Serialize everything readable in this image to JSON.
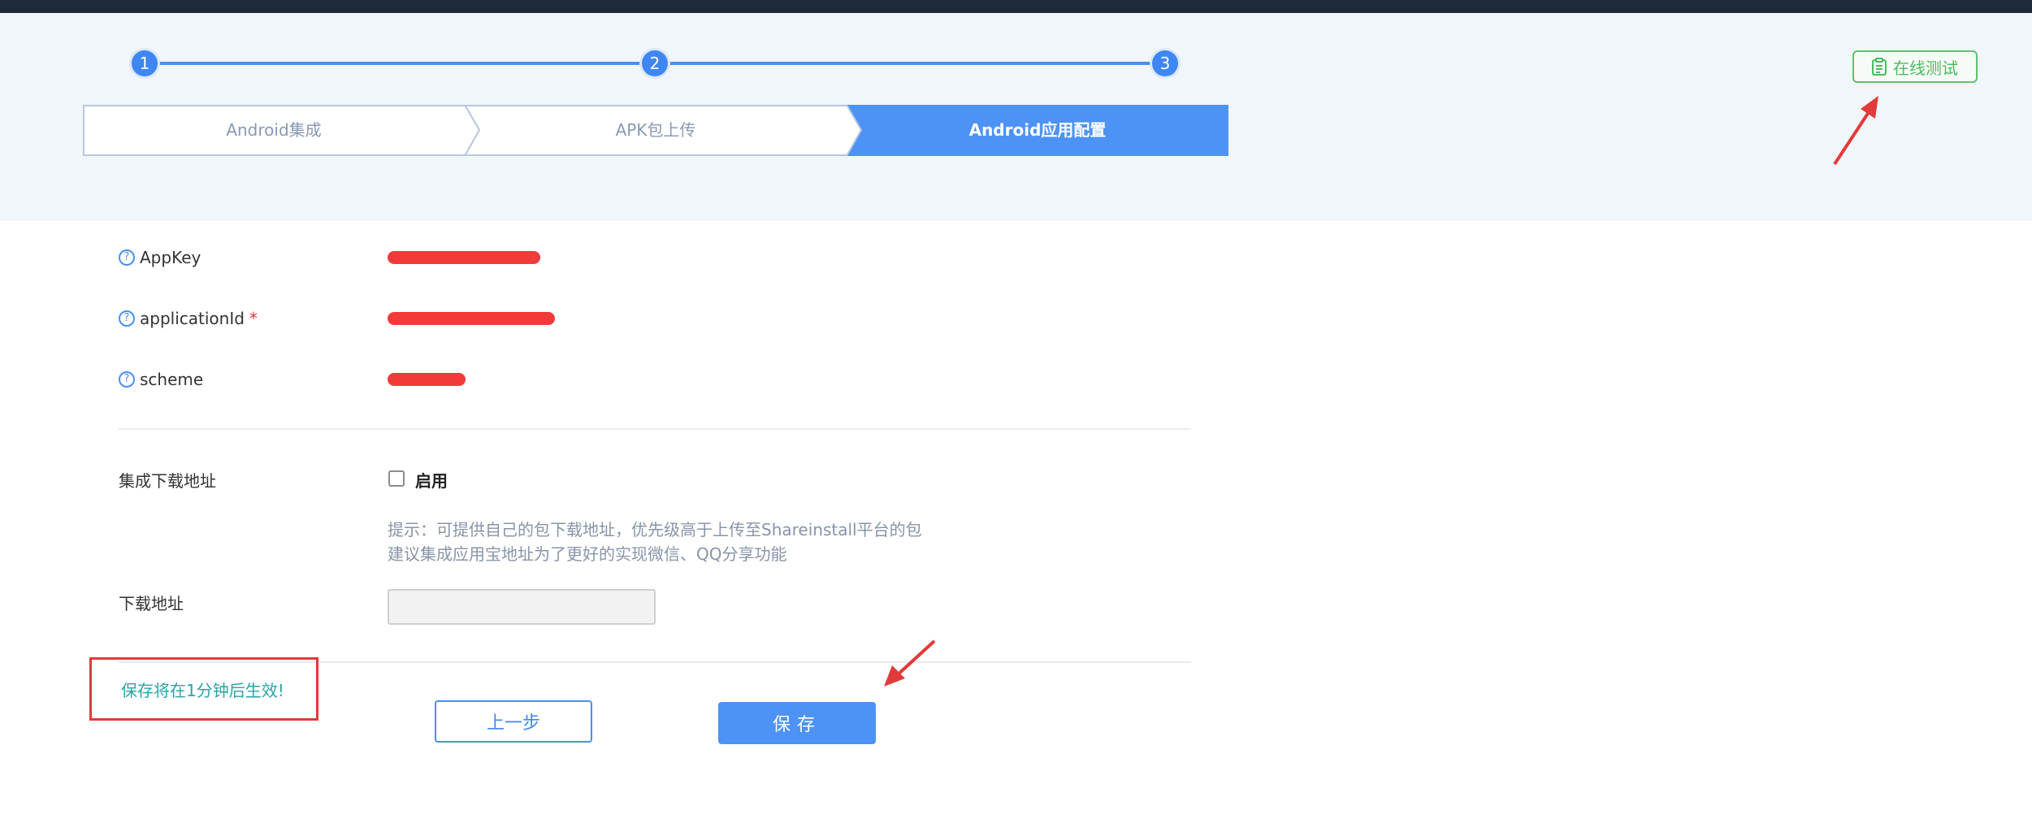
{
  "steps": {
    "numbers": [
      "1",
      "2",
      "3"
    ],
    "tabs": [
      {
        "label": "Android集成",
        "active": false
      },
      {
        "label": "APK包上传",
        "active": false
      },
      {
        "label": "Android应用配置",
        "active": true
      }
    ]
  },
  "header": {
    "online_test_label": "在线测试",
    "online_test_icon": "clipboard-check-icon"
  },
  "form": {
    "help_icon_glyph": "?",
    "appkey": {
      "label": "AppKey"
    },
    "application_id": {
      "label": "applicationId",
      "required_mark": "*"
    },
    "scheme": {
      "label": "scheme"
    },
    "download_integration": {
      "label": "集成下载地址",
      "checkbox_label": "启用",
      "checked": false
    },
    "hint_line1": "提示：可提供自己的包下载地址，优先级高于上传至Shareinstall平台的包",
    "hint_line2": "建议集成应用宝地址为了更好的实现微信、QQ分享功能",
    "download_url": {
      "label": "下载地址",
      "value": ""
    }
  },
  "footer": {
    "notice": "保存将在1分钟后生效!",
    "prev_label": "上一步",
    "save_label": "保存"
  },
  "colors": {
    "accent": "#4d93f6",
    "success": "#4cbb5e",
    "annotation_red": "#e23a3a",
    "notice_text": "#2aa3a5"
  }
}
